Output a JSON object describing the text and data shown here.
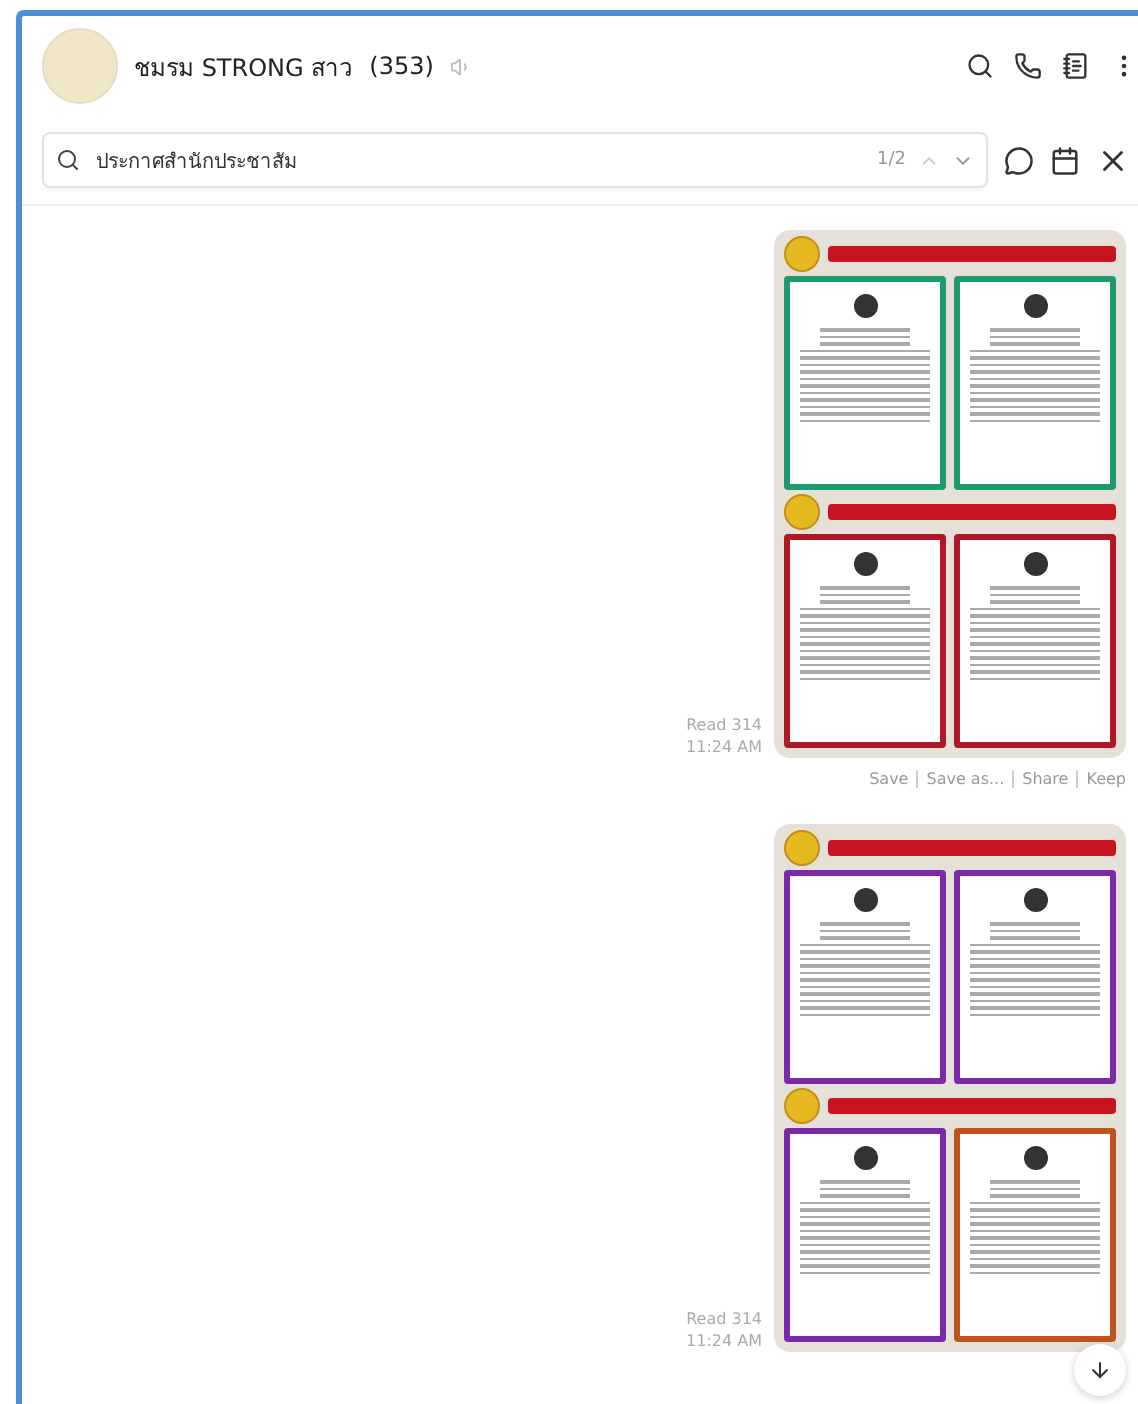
{
  "chat": {
    "title": "ชมรม STRONG สาว",
    "member_count": "(353)",
    "muted": true
  },
  "search": {
    "value": "ประกาศสำนักประชาสัม",
    "match_count": "1/2"
  },
  "messages": [
    {
      "read": "Read 314",
      "time": "11:24 AM",
      "actions": [
        "Save",
        "Save as...",
        "Share",
        "Keep"
      ],
      "pages": [
        {
          "color": "#1e9a6e"
        },
        {
          "color": "#1e9a6e"
        },
        {
          "color": "#b0182a"
        },
        {
          "color": "#b0182a"
        }
      ]
    },
    {
      "read": "Read 314",
      "time": "11:24 AM",
      "pages": [
        {
          "color": "#7a2aa8"
        },
        {
          "color": "#7a2aa8"
        },
        {
          "color": "#7a2aa8"
        },
        {
          "color": "#c0521e"
        }
      ]
    }
  ]
}
